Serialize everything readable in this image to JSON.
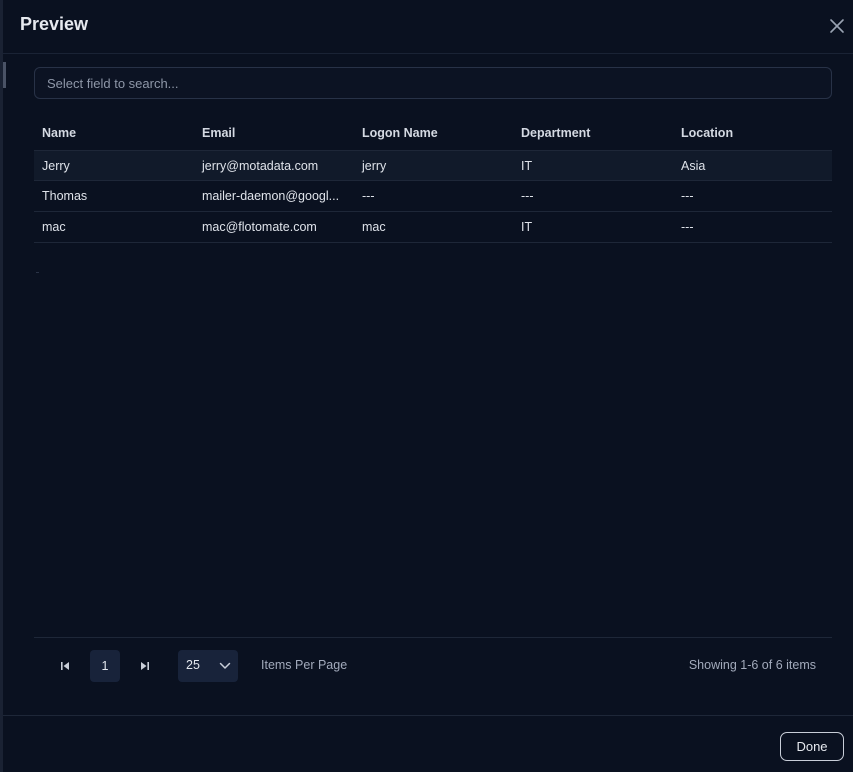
{
  "dialog": {
    "title": "Preview"
  },
  "search": {
    "placeholder": "Select field to search...",
    "value": ""
  },
  "table": {
    "columns": [
      "Name",
      "Email",
      "Logon Name",
      "Department",
      "Location"
    ],
    "rows": [
      [
        "Jerry",
        "jerry@motadata.com",
        "jerry",
        "IT",
        "Asia"
      ],
      [
        "Thomas",
        "mailer-daemon@googl...",
        "---",
        "---",
        "---"
      ],
      [
        "mac",
        "mac@flotomate.com",
        "mac",
        "IT",
        "---"
      ]
    ]
  },
  "pagination": {
    "current_page": "1",
    "items_per_page": "25",
    "items_per_page_label": "Items Per Page",
    "showing_text": "Showing 1-6 of 6 items"
  },
  "footer": {
    "done_label": "Done"
  },
  "icons": {
    "close": "close-icon",
    "first_page": "first-page-icon",
    "last_page": "last-page-icon",
    "dropdown": "chevron-down-icon"
  },
  "colors": {
    "background": "#0a1120",
    "row_highlight": "#111a2a",
    "control_bg": "#18233a",
    "text": "#dfe3ea",
    "muted_text": "#a2aabb"
  }
}
